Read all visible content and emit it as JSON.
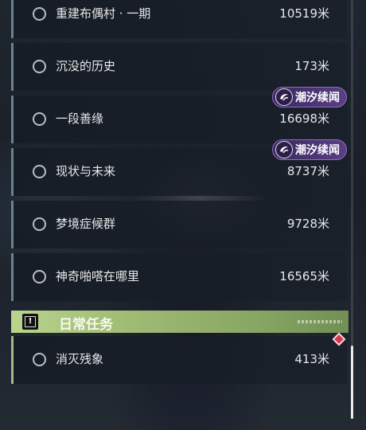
{
  "quests": [
    {
      "name": "重建布偶村 · 一期",
      "distance": "10519米",
      "badge": null
    },
    {
      "name": "沉没的历史",
      "distance": "173米",
      "badge": null
    },
    {
      "name": "一段善缘",
      "distance": "16698米",
      "badge": "潮汐续闻"
    },
    {
      "name": "现状与未来",
      "distance": "8737米",
      "badge": "潮汐续闻"
    },
    {
      "name": "梦境症候群",
      "distance": "9728米",
      "badge": null
    },
    {
      "name": "神奇啪嗒在哪里",
      "distance": "16565米",
      "badge": null
    }
  ],
  "daily_section": {
    "title": "日常任务",
    "icon": "exclamation-icon",
    "quests": [
      {
        "name": "消灭残象",
        "distance": "413米"
      }
    ]
  },
  "colors": {
    "badge_purple": "#5a3f86",
    "section_green": "#a4b88a",
    "tracker_red": "#d8344a"
  }
}
